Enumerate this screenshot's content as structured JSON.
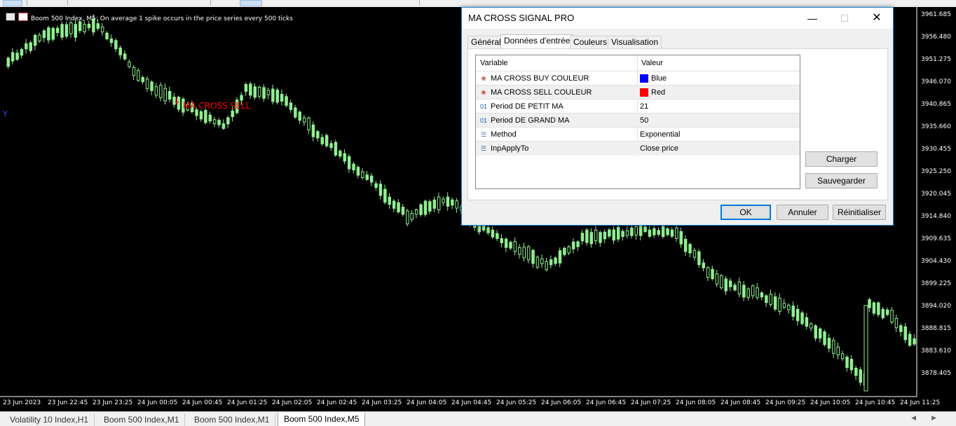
{
  "chart": {
    "info_text": "Boom 500 Index, M5:  On average 1 spike occurs in the price series every 500 ticks",
    "signal_label": "MA CROSS SELL",
    "signal_arrow": "↓",
    "left_mark": "Y",
    "y_labels": [
      "3961.685",
      "3956.480",
      "3951.275",
      "3946.070",
      "3940.865",
      "3935.660",
      "3930.455",
      "3925.250",
      "3920.045",
      "3914.840",
      "3909.635",
      "3904.430",
      "3899.225",
      "3894.020",
      "3888.815",
      "3883.610",
      "3878.405"
    ],
    "x_labels": [
      "23 Jun 2023",
      "23 Jun 22:45",
      "23 Jun 23:25",
      "24 Jun 00:05",
      "24 Jun 00:45",
      "24 Jun 01:25",
      "24 Jun 02:05",
      "24 Jun 02:45",
      "24 Jun 03:25",
      "24 Jun 04:05",
      "24 Jun 04:45",
      "24 Jun 05:25",
      "24 Jun 06:05",
      "24 Jun 06:45",
      "24 Jun 07:25",
      "24 Jun 08:05",
      "24 Jun 08:45",
      "24 Jun 09:25",
      "24 Jun 10:05",
      "24 Jun 10:45",
      "24 Jun 11:25"
    ],
    "candle_color": "#90ee90",
    "background": "#000000"
  },
  "chart_tabs": [
    {
      "label": "Volatility 10 Index,H1"
    },
    {
      "label": "Boom 500 Index,M1"
    },
    {
      "label": "Boom 500 Index,M1"
    },
    {
      "label": "Boom 500 Index,M5",
      "active": true
    }
  ],
  "dialog": {
    "title": "MA CROSS SIGNAL PRO",
    "window_buttons": {
      "minimize": "—",
      "maximize": "☐",
      "close": "✕"
    },
    "tabs": [
      "Général",
      "Données d'entrée",
      "Couleurs",
      "Visualisation"
    ],
    "active_tab": "Données d'entrée",
    "columns": {
      "variable": "Variable",
      "value": "Valeur"
    },
    "params": [
      {
        "icon": "color-param-icon",
        "glyph": "❀",
        "name": "MA CROSS BUY COULEUR",
        "value": "Blue",
        "swatch": "#0000ff"
      },
      {
        "icon": "color-param-icon",
        "glyph": "❀",
        "name": "MA CROSS SELL COULEUR",
        "value": "Red",
        "swatch": "#ff0000"
      },
      {
        "icon": "int-param-icon",
        "glyph": "01",
        "name": "Period DE PETIT MA",
        "value": "21"
      },
      {
        "icon": "int-param-icon",
        "glyph": "01",
        "name": "Period DE GRAND MA",
        "value": "50"
      },
      {
        "icon": "enum-param-icon",
        "glyph": "☰",
        "name": "Method",
        "value": "Exponential"
      },
      {
        "icon": "enum-param-icon",
        "glyph": "☰",
        "name": "InpApplyTo",
        "value": "Close price"
      }
    ],
    "side_buttons": {
      "load": "Charger",
      "save": "Sauvegarder"
    },
    "footer_buttons": {
      "ok": "OK",
      "cancel": "Annuler",
      "reset": "Réinitialiser"
    }
  }
}
